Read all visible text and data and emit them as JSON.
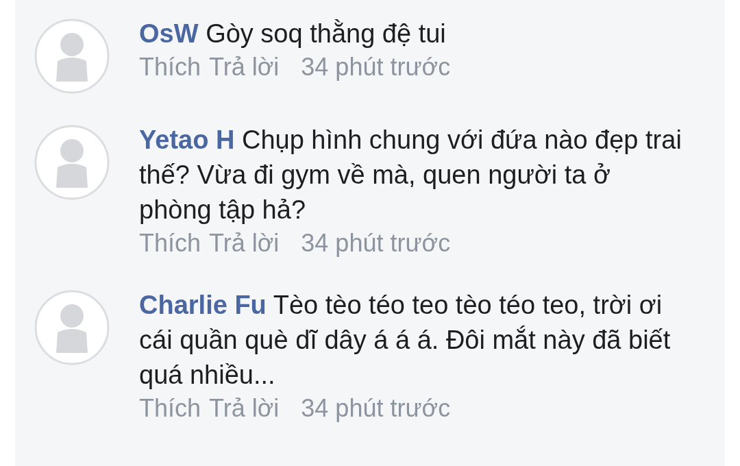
{
  "comments": [
    {
      "author": "OsW",
      "text": "Gòy soq thằng đệ tui",
      "actions": [
        "Thích",
        "Trả lời"
      ],
      "time": "34 phút trước"
    },
    {
      "author": "Yetao H",
      "text": "Chụp hình chung với đứa nào đẹp trai thế? Vừa đi gym về mà, quen người ta ở phòng tập hả?",
      "actions": [
        "Thích",
        "Trả lời"
      ],
      "time": "34 phút trước"
    },
    {
      "author": "Charlie Fu",
      "text": "Tèo tèo téo teo tèo téo teo, trời ơi cái quần què dĩ dây á á á. Đôi mắt này đã biết quá nhiều...",
      "actions": [
        "Thích",
        "Trả lời"
      ],
      "time": "34 phút trước"
    }
  ]
}
